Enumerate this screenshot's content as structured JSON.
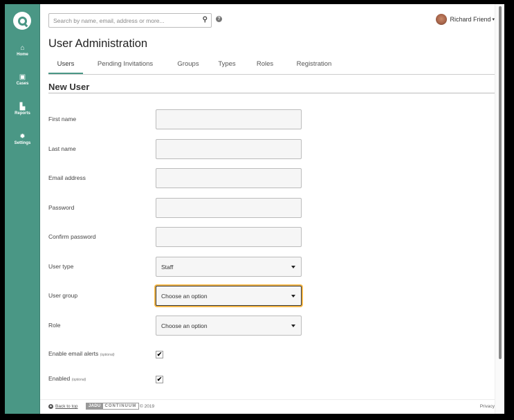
{
  "sidebar": {
    "logo": "q-logo-icon",
    "items": [
      {
        "label": "Home",
        "icon": "home-icon"
      },
      {
        "label": "Cases",
        "icon": "archive-icon"
      },
      {
        "label": "Reports",
        "icon": "bar-chart-icon"
      },
      {
        "label": "Settings",
        "icon": "gear-icon"
      }
    ]
  },
  "header": {
    "search_placeholder": "Search by name, email, address or more...",
    "search_icon": "search-icon",
    "help_icon": "help-icon",
    "user_name": "Richard Friend",
    "user_caret": "▾"
  },
  "page": {
    "title": "User Administration",
    "tabs": [
      {
        "label": "Users",
        "active": true
      },
      {
        "label": "Pending Invitations",
        "active": false
      },
      {
        "label": "Groups",
        "active": false
      },
      {
        "label": "Types",
        "active": false
      },
      {
        "label": "Roles",
        "active": false
      },
      {
        "label": "Registration",
        "active": false
      }
    ],
    "section_title": "New User"
  },
  "form": {
    "first_name": {
      "label": "First name",
      "value": ""
    },
    "last_name": {
      "label": "Last name",
      "value": ""
    },
    "email": {
      "label": "Email address",
      "value": ""
    },
    "password": {
      "label": "Password",
      "value": ""
    },
    "confirm_password": {
      "label": "Confirm password",
      "value": ""
    },
    "user_type": {
      "label": "User type",
      "value": "Staff"
    },
    "user_group": {
      "label": "User group",
      "value": "Choose an option"
    },
    "role": {
      "label": "Role",
      "value": "Choose an option"
    },
    "email_alerts": {
      "label": "Enable email alerts",
      "optional": "(optional)",
      "checked": true,
      "mark": "✔"
    },
    "enabled": {
      "label": "Enabled",
      "optional": "(optional)",
      "checked": true,
      "mark": "✔"
    }
  },
  "footer": {
    "back_to_top": "Back to top",
    "brand_a": "JADU",
    "brand_b": "CONTINUUM",
    "copyright": "© 2019",
    "privacy": "Privacy"
  },
  "colors": {
    "accent": "#4a9785",
    "focus": "#f5b84a"
  }
}
